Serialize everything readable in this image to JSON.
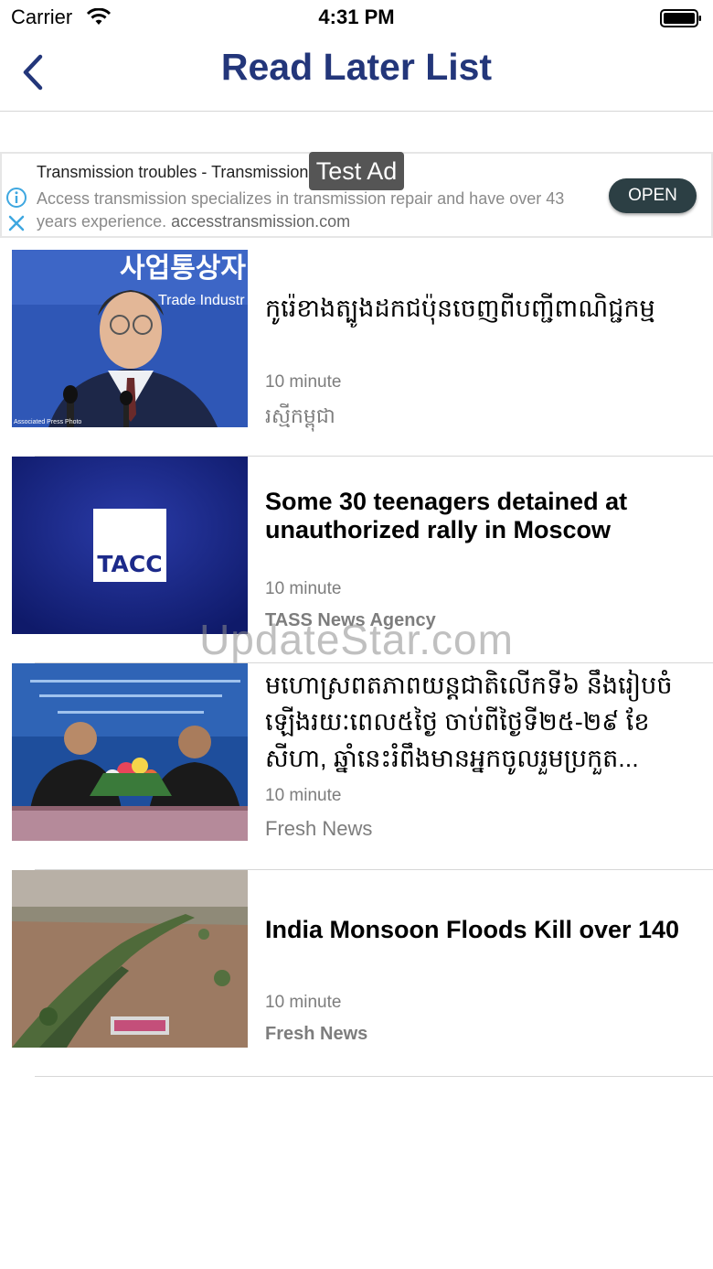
{
  "status_bar": {
    "carrier": "Carrier",
    "time": "4:31 PM"
  },
  "nav": {
    "title": "Read Later List",
    "back_icon": "chevron-left-icon",
    "accent_color": "#23367a"
  },
  "ad": {
    "badge": "Test Ad",
    "title": "Transmission troubles - Transmission",
    "description": "Access transmission specializes in transmission repair and have over 43 years experience.",
    "domain": "accesstransmission.com",
    "cta_label": "OPEN"
  },
  "articles": [
    {
      "title": "កូរ៉េខាងត្បូងដកជប៉ុនចេញពីបញ្ជីពាណិជ្ជកម្ម",
      "time": "10 minute",
      "source": "រស្មីកម្ពុជា",
      "thumbnail": "speaker-at-podium"
    },
    {
      "title": "Some 30 teenagers detained at unauthorized rally in Moscow",
      "time": "10 minute",
      "source": "TASS News Agency",
      "thumbnail": "tass-logo",
      "thumb_logo": "TACC"
    },
    {
      "title": "មហោស្រពតភាពយន្តជាតិលើកទី៦ នឹងរៀបចំឡើងរយៈពេល៥ថ្ងៃ ចាប់ពីថ្ងៃទី២៥-២៩ ខែសីហា, ឆ្នាំនេះរំពឹងមានអ្នកចូលរួមប្រកួត...",
      "time": "10 minute",
      "source": "Fresh News",
      "thumbnail": "press-conference"
    },
    {
      "title": "India Monsoon Floods Kill over 140",
      "time": "10 minute",
      "source": "Fresh News",
      "thumbnail": "flood-aerial"
    }
  ],
  "watermark": "UpdateStar.com"
}
